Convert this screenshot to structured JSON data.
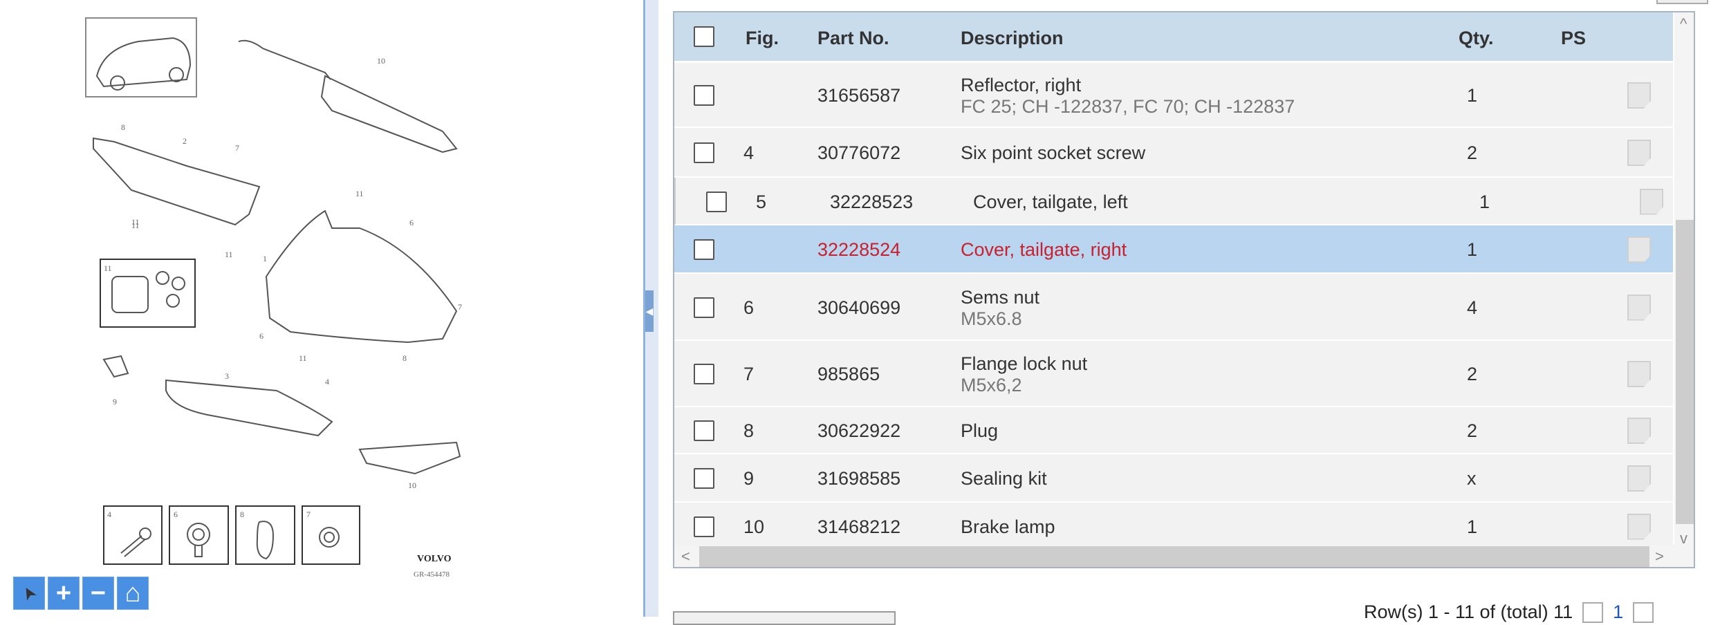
{
  "diagram": {
    "callouts": [
      "10",
      "8",
      "2",
      "7",
      "11",
      "11",
      "11",
      "1",
      "6",
      "6",
      "7",
      "11",
      "8",
      "11",
      "9",
      "3",
      "4",
      "10"
    ],
    "inset_labels": [
      "11"
    ],
    "fasteners": [
      {
        "fig": "4",
        "name": "screw"
      },
      {
        "fig": "6",
        "name": "sems-nut"
      },
      {
        "fig": "8",
        "name": "plug"
      },
      {
        "fig": "7",
        "name": "flange-lock-nut"
      }
    ],
    "logo": "VOLVO",
    "ref": "GR-454478"
  },
  "toolbar": {
    "tools": [
      {
        "name": "select",
        "glyph": "➤"
      },
      {
        "name": "zoom-in",
        "glyph": "+"
      },
      {
        "name": "zoom-out",
        "glyph": "−"
      },
      {
        "name": "home",
        "glyph": "⌂"
      }
    ]
  },
  "table": {
    "headers": {
      "fig": "Fig.",
      "part": "Part No.",
      "desc": "Description",
      "qty": "Qty.",
      "ps": "PS"
    },
    "rows": [
      {
        "fig": "",
        "part": "31656587",
        "desc": "Reflector, right",
        "sub": "FC 25; CH -122837, FC 70; CH -122837",
        "qty": "1"
      },
      {
        "fig": "4",
        "part": "30776072",
        "desc": "Six point socket screw",
        "sub": "",
        "qty": "2"
      },
      {
        "fig": "5",
        "part": "32228523",
        "desc": "Cover, tailgate, left",
        "sub": "",
        "qty": "1"
      },
      {
        "fig": "",
        "part": "32228524",
        "desc": "Cover, tailgate, right",
        "sub": "",
        "qty": "1"
      },
      {
        "fig": "6",
        "part": "30640699",
        "desc": "Sems nut",
        "sub": "M5x6.8",
        "qty": "4"
      },
      {
        "fig": "7",
        "part": "985865",
        "desc": "Flange lock nut",
        "sub": "M5x6,2",
        "qty": "2"
      },
      {
        "fig": "8",
        "part": "30622922",
        "desc": "Plug",
        "sub": "",
        "qty": "2"
      },
      {
        "fig": "9",
        "part": "31698585",
        "desc": "Sealing kit",
        "sub": "",
        "qty": "x"
      },
      {
        "fig": "10",
        "part": "31468212",
        "desc": "Brake lamp",
        "sub": "",
        "qty": "1"
      }
    ],
    "selected_index": 3,
    "accent_selected": "#c8202f"
  },
  "pager": {
    "text": "Row(s) 1 - 11 of (total) 11",
    "page": "1"
  }
}
